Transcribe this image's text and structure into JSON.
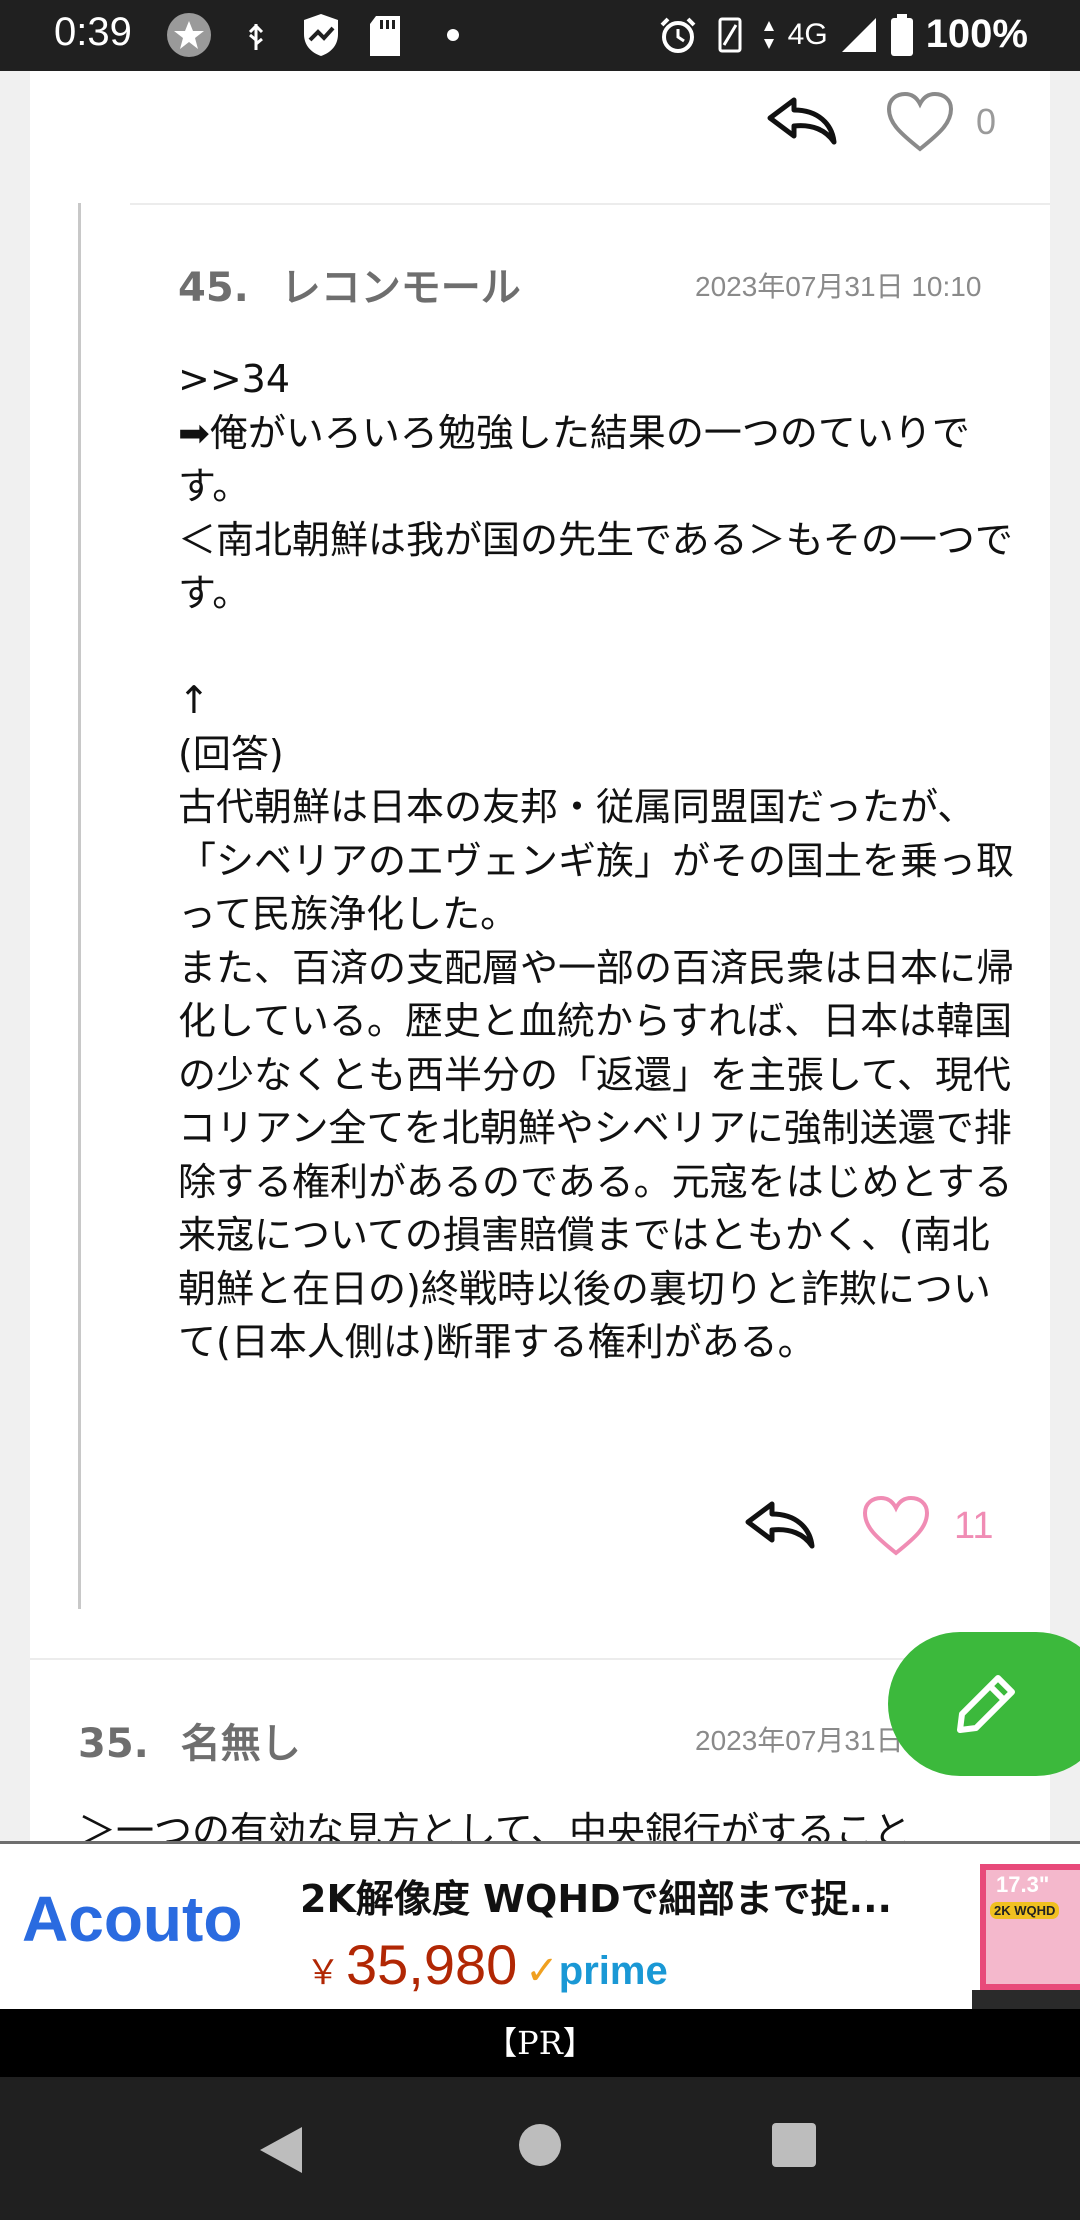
{
  "status_bar": {
    "time": "0:39",
    "network": "4G",
    "battery": "100%",
    "icons": [
      "star-notification-icon",
      "usb-icon",
      "vpn-shield-icon",
      "sd-card-icon",
      "dot-icon",
      "alarm-icon",
      "vibrate-icon",
      "data-arrows-icon",
      "signal-icon",
      "battery-icon"
    ]
  },
  "previous_post": {
    "like_count": "0"
  },
  "reply_post": {
    "number": "45.",
    "author": "レコンモール",
    "date": "2023年07月31日 10:10",
    "body": ">>34\n➡俺がいろいろ勉強した結果の一つのていりです。\n＜南北朝鮮は我が国の先生である＞もその一つです。\n\n↑\n(回答)\n古代朝鮮は日本の友邦・従属同盟国だったが、「シベリアのエヴェンギ族」がその国土を乗っ取って民族浄化した。\nまた、百済の支配層や一部の百済民衆は日本に帰化している。歴史と血統からすれば、日本は韓国の少なくとも西半分の「返還」を主張して、現代コリアン全てを北朝鮮やシベリアに強制送還で排除する権利があるのである。元寇をはじめとする来寇についての損害賠償まではともかく、(南北朝鮮と在日の)終戦時以後の裏切りと詐欺について(日本人側は)断罪する権利がある。",
    "like_count": "11"
  },
  "next_post": {
    "number": "35.",
    "author": "名無し",
    "date": "2023年07月31日",
    "body_preview": "＞一つの有効な見方として、中央銀行がすること"
  },
  "ad": {
    "brand": "Acouto",
    "title": "2K解像度 WQHDで細部まで捉...",
    "currency": "￥",
    "price": "35,980",
    "checkmark": "✓",
    "prime": "prime",
    "image_text_size": "17.3\"",
    "image_text_badge": "2K WQHD"
  },
  "pr_label": "【PR】",
  "colors": {
    "accent_green": "#3cb93c",
    "like_pink": "#f08cb4",
    "ad_blue": "#2a6be0",
    "price_red": "#b12704"
  }
}
